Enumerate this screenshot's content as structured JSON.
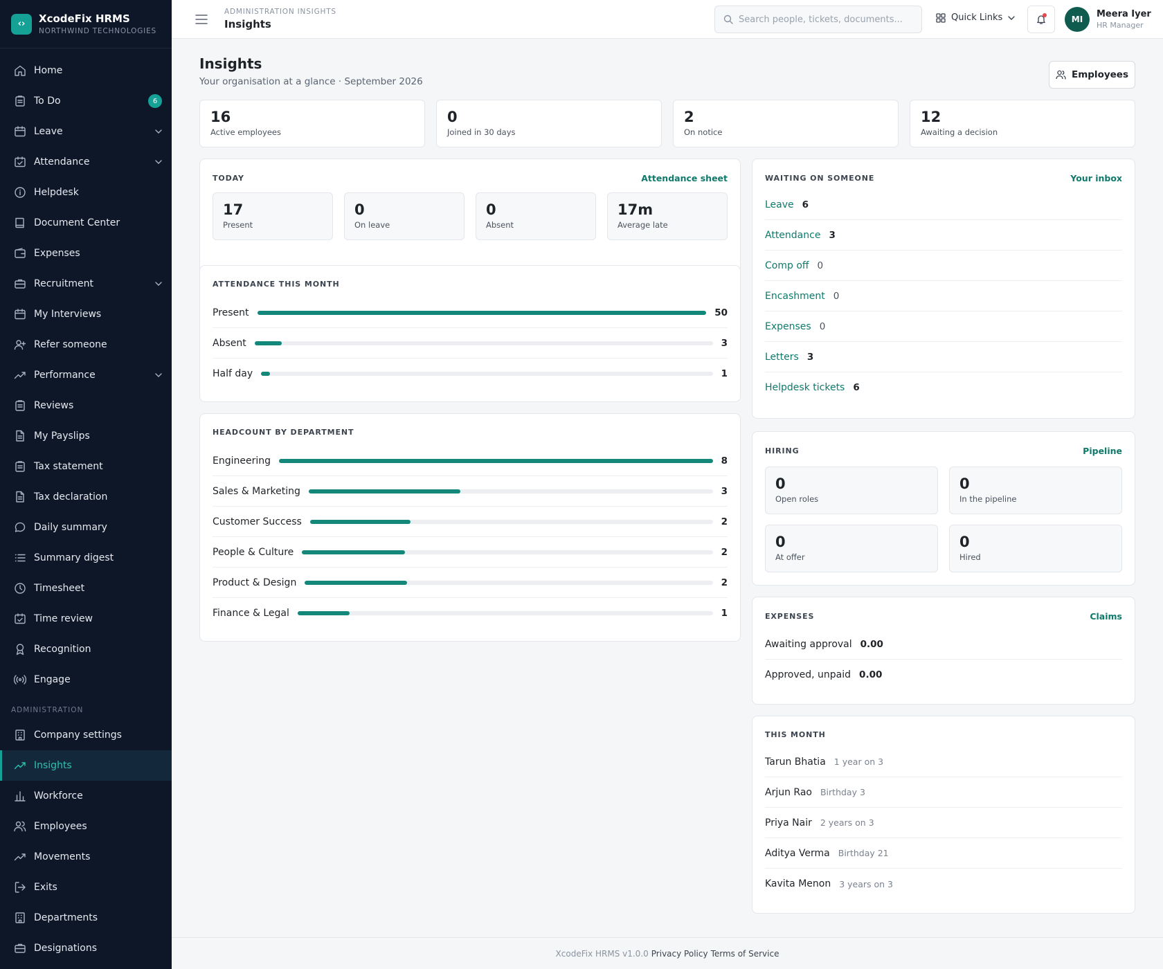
{
  "brand": {
    "name": "XcodeFix HRMS",
    "org": "NORTHWIND TECHNOLOGIES",
    "logo_glyph": "‹›",
    "accent": "#15a196"
  },
  "sidebar": {
    "items": [
      {
        "label": "Home",
        "icon": "home-icon"
      },
      {
        "label": "To Do",
        "icon": "clipboard-icon",
        "badge": "6"
      },
      {
        "label": "Leave",
        "icon": "calendar-icon",
        "expandable": true
      },
      {
        "label": "Attendance",
        "icon": "calendar-check-icon",
        "expandable": true
      },
      {
        "label": "Helpdesk",
        "icon": "info-icon"
      },
      {
        "label": "Document Center",
        "icon": "book-icon"
      },
      {
        "label": "Expenses",
        "icon": "wallet-icon"
      },
      {
        "label": "Recruitment",
        "icon": "briefcase-icon",
        "expandable": true
      },
      {
        "label": "My Interviews",
        "icon": "calendar-icon"
      },
      {
        "label": "Refer someone",
        "icon": "user-plus-icon"
      },
      {
        "label": "Performance",
        "icon": "trending-up-icon",
        "expandable": true
      },
      {
        "label": "Reviews",
        "icon": "clipboard-icon"
      },
      {
        "label": "My Payslips",
        "icon": "file-icon"
      },
      {
        "label": "Tax statement",
        "icon": "clipboard-icon"
      },
      {
        "label": "Tax declaration",
        "icon": "file-icon"
      },
      {
        "label": "Daily summary",
        "icon": "chat-icon"
      },
      {
        "label": "Summary digest",
        "icon": "list-icon"
      },
      {
        "label": "Timesheet",
        "icon": "clock-icon"
      },
      {
        "label": "Time review",
        "icon": "calendar-check-icon"
      },
      {
        "label": "Recognition",
        "icon": "award-icon"
      },
      {
        "label": "Engage",
        "icon": "broadcast-icon"
      }
    ],
    "admin_section": "ADMINISTRATION",
    "admin_items": [
      {
        "label": "Company settings",
        "icon": "building-icon"
      },
      {
        "label": "Insights",
        "icon": "trending-up-icon",
        "active": true
      },
      {
        "label": "Workforce",
        "icon": "bar-chart-icon"
      },
      {
        "label": "Employees",
        "icon": "users-icon"
      },
      {
        "label": "Movements",
        "icon": "trending-up-icon"
      },
      {
        "label": "Exits",
        "icon": "log-out-icon"
      },
      {
        "label": "Departments",
        "icon": "building-icon"
      },
      {
        "label": "Designations",
        "icon": "briefcase-icon"
      }
    ]
  },
  "topbar": {
    "breadcrumb": "ADMINISTRATION INSIGHTS",
    "title": "Insights",
    "search_placeholder": "Search people, tickets, documents...",
    "quick_links": "Quick Links",
    "user": {
      "initials": "MI",
      "name": "Meera Iyer",
      "role": "HR Manager"
    }
  },
  "page": {
    "title": "Insights",
    "subtitle": "Your organisation at a glance · September 2026",
    "employees_button": "Employees"
  },
  "kpis": [
    {
      "value": "16",
      "label": "Active employees"
    },
    {
      "value": "0",
      "label": "Joined in 30 days"
    },
    {
      "value": "2",
      "label": "On notice"
    },
    {
      "value": "12",
      "label": "Awaiting a decision"
    }
  ],
  "today": {
    "title": "TODAY",
    "link": "Attendance sheet",
    "stats": [
      {
        "value": "17",
        "label": "Present"
      },
      {
        "value": "0",
        "label": "On leave"
      },
      {
        "value": "0",
        "label": "Absent"
      },
      {
        "value": "17m",
        "label": "Average late"
      }
    ]
  },
  "attendance_month": {
    "title": "ATTENDANCE THIS MONTH",
    "rows": [
      {
        "label": "Present",
        "value": 50,
        "fraction": 1.0
      },
      {
        "label": "Absent",
        "value": 3,
        "fraction": 0.06
      },
      {
        "label": "Half day",
        "value": 1,
        "fraction": 0.02
      }
    ]
  },
  "headcount": {
    "title": "HEADCOUNT BY DEPARTMENT",
    "rows": [
      {
        "label": "Engineering",
        "value": 8,
        "fraction": 1.0
      },
      {
        "label": "Sales & Marketing",
        "value": 3,
        "fraction": 0.375
      },
      {
        "label": "Customer Success",
        "value": 2,
        "fraction": 0.25
      },
      {
        "label": "People & Culture",
        "value": 2,
        "fraction": 0.25
      },
      {
        "label": "Product & Design",
        "value": 2,
        "fraction": 0.25
      },
      {
        "label": "Finance & Legal",
        "value": 1,
        "fraction": 0.125
      }
    ]
  },
  "waiting": {
    "title": "WAITING ON SOMEONE",
    "link": "Your inbox",
    "rows": [
      {
        "label": "Leave",
        "count": "6"
      },
      {
        "label": "Attendance",
        "count": "3"
      },
      {
        "label": "Comp off",
        "count": "0"
      },
      {
        "label": "Encashment",
        "count": "0"
      },
      {
        "label": "Expenses",
        "count": "0"
      },
      {
        "label": "Letters",
        "count": "3"
      },
      {
        "label": "Helpdesk tickets",
        "count": "6"
      }
    ]
  },
  "hiring": {
    "title": "HIRING",
    "link": "Pipeline",
    "stats": [
      {
        "value": "0",
        "label": "Open roles"
      },
      {
        "value": "0",
        "label": "In the pipeline"
      },
      {
        "value": "0",
        "label": "At offer"
      },
      {
        "value": "0",
        "label": "Hired"
      }
    ]
  },
  "expenses": {
    "title": "EXPENSES",
    "link": "Claims",
    "rows": [
      {
        "label": "Awaiting approval",
        "value": "0.00"
      },
      {
        "label": "Approved, unpaid",
        "value": "0.00"
      }
    ]
  },
  "this_month": {
    "title": "THIS MONTH",
    "rows": [
      {
        "name": "Tarun Bhatia",
        "note": "1 year on 3"
      },
      {
        "name": "Arjun Rao",
        "note": "Birthday 3"
      },
      {
        "name": "Priya Nair",
        "note": "2 years on 3"
      },
      {
        "name": "Aditya Verma",
        "note": "Birthday 21"
      },
      {
        "name": "Kavita Menon",
        "note": "3 years on 3"
      }
    ]
  },
  "footer": {
    "version": "XcodeFix HRMS v1.0.0",
    "privacy": "Privacy Policy",
    "terms": "Terms of Service"
  },
  "colors": {
    "sidebar_bg": "#0d1728",
    "accent": "#15a196",
    "bar": "#13887a",
    "link": "#0f7a6b"
  }
}
